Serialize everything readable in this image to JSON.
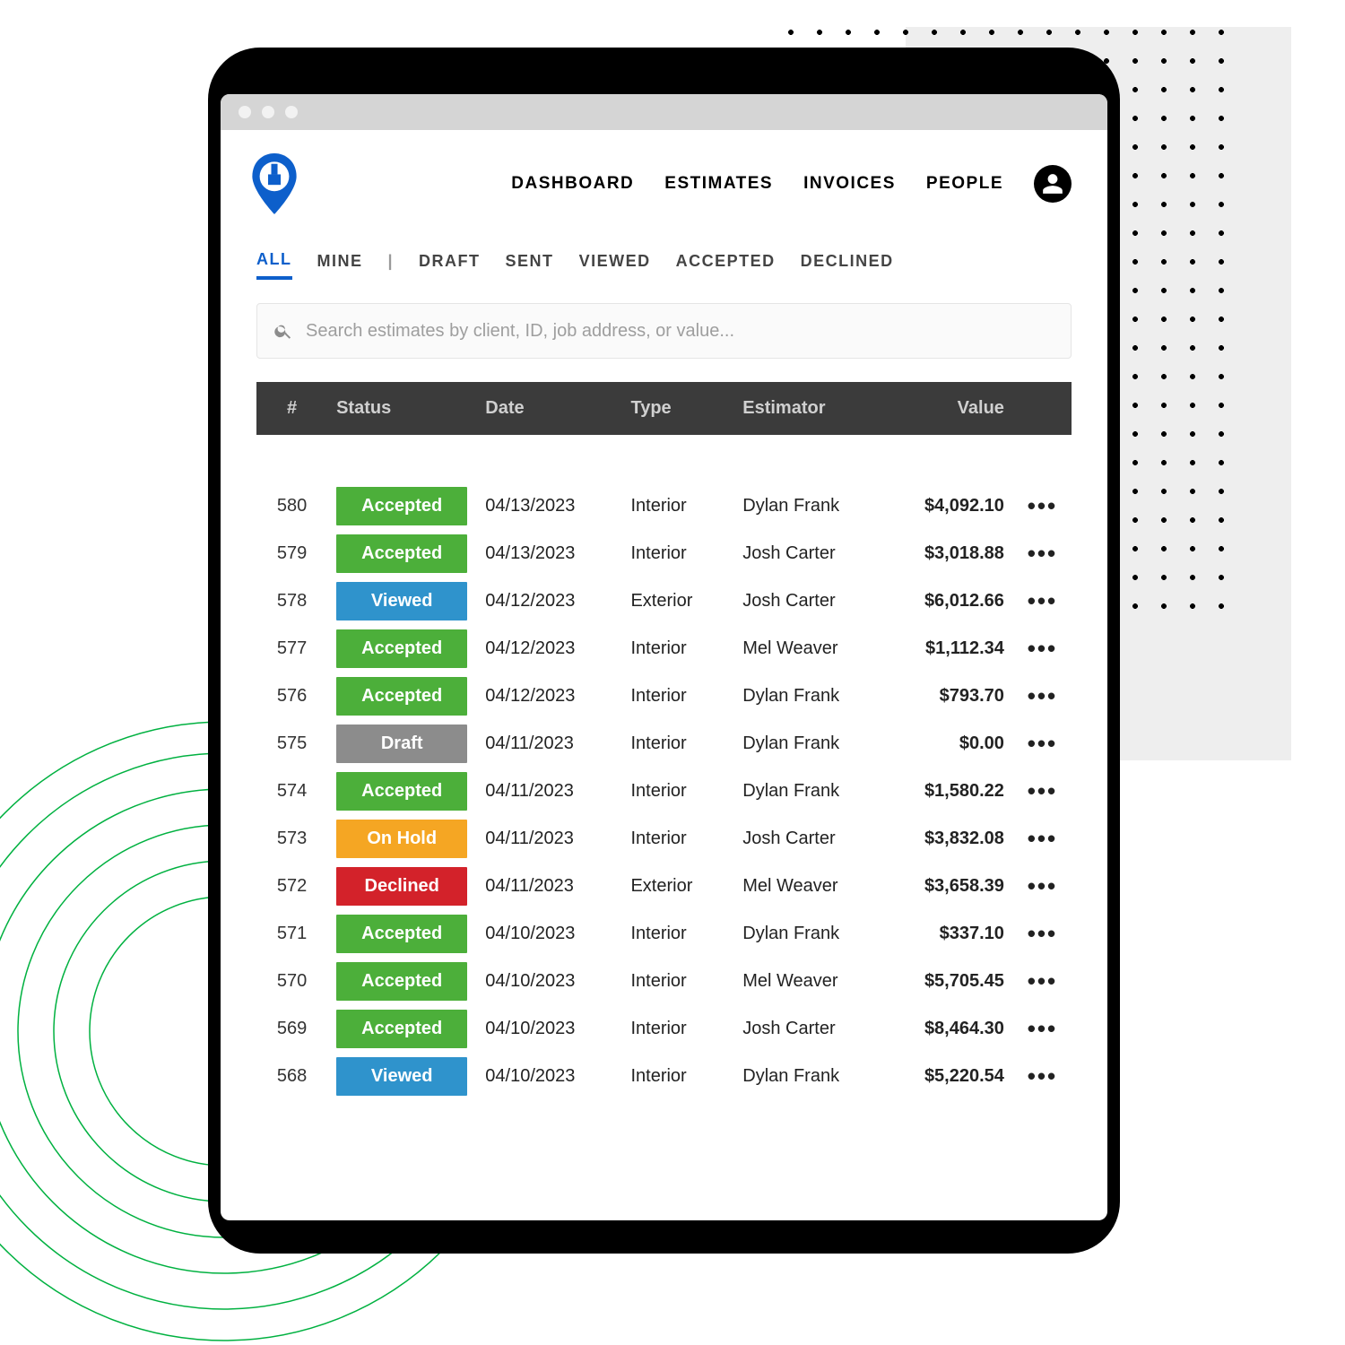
{
  "nav": {
    "items": [
      "DASHBOARD",
      "ESTIMATES",
      "INVOICES",
      "PEOPLE"
    ]
  },
  "filters": {
    "items": [
      "ALL",
      "MINE",
      "|",
      "DRAFT",
      "SENT",
      "VIEWED",
      "ACCEPTED",
      "DECLINED"
    ],
    "active_index": 0
  },
  "search": {
    "placeholder": "Search estimates by client, ID, job address, or value..."
  },
  "table": {
    "headers": {
      "id": "#",
      "status": "Status",
      "date": "Date",
      "type": "Type",
      "estimator": "Estimator",
      "value": "Value"
    },
    "status_colors": {
      "Accepted": "#4CAF3A",
      "Viewed": "#2F93CC",
      "Draft": "#8C8C8C",
      "On Hold": "#F5A623",
      "Declined": "#D3222A"
    },
    "rows": [
      {
        "id": "580",
        "status": "Accepted",
        "date": "04/13/2023",
        "type": "Interior",
        "estimator": "Dylan Frank",
        "value": "$4,092.10"
      },
      {
        "id": "579",
        "status": "Accepted",
        "date": "04/13/2023",
        "type": "Interior",
        "estimator": "Josh Carter",
        "value": "$3,018.88"
      },
      {
        "id": "578",
        "status": "Viewed",
        "date": "04/12/2023",
        "type": "Exterior",
        "estimator": "Josh Carter",
        "value": "$6,012.66"
      },
      {
        "id": "577",
        "status": "Accepted",
        "date": "04/12/2023",
        "type": "Interior",
        "estimator": "Mel Weaver",
        "value": "$1,112.34"
      },
      {
        "id": "576",
        "status": "Accepted",
        "date": "04/12/2023",
        "type": "Interior",
        "estimator": "Dylan Frank",
        "value": "$793.70"
      },
      {
        "id": "575",
        "status": "Draft",
        "date": "04/11/2023",
        "type": "Interior",
        "estimator": "Dylan Frank",
        "value": "$0.00"
      },
      {
        "id": "574",
        "status": "Accepted",
        "date": "04/11/2023",
        "type": "Interior",
        "estimator": "Dylan Frank",
        "value": "$1,580.22"
      },
      {
        "id": "573",
        "status": "On Hold",
        "date": "04/11/2023",
        "type": "Interior",
        "estimator": "Josh Carter",
        "value": "$3,832.08"
      },
      {
        "id": "572",
        "status": "Declined",
        "date": "04/11/2023",
        "type": "Exterior",
        "estimator": "Mel Weaver",
        "value": "$3,658.39"
      },
      {
        "id": "571",
        "status": "Accepted",
        "date": "04/10/2023",
        "type": "Interior",
        "estimator": "Dylan Frank",
        "value": "$337.10"
      },
      {
        "id": "570",
        "status": "Accepted",
        "date": "04/10/2023",
        "type": "Interior",
        "estimator": "Mel Weaver",
        "value": "$5,705.45"
      },
      {
        "id": "569",
        "status": "Accepted",
        "date": "04/10/2023",
        "type": "Interior",
        "estimator": "Josh Carter",
        "value": "$8,464.30"
      },
      {
        "id": "568",
        "status": "Viewed",
        "date": "04/10/2023",
        "type": "Interior",
        "estimator": "Dylan Frank",
        "value": "$5,220.54"
      }
    ]
  }
}
